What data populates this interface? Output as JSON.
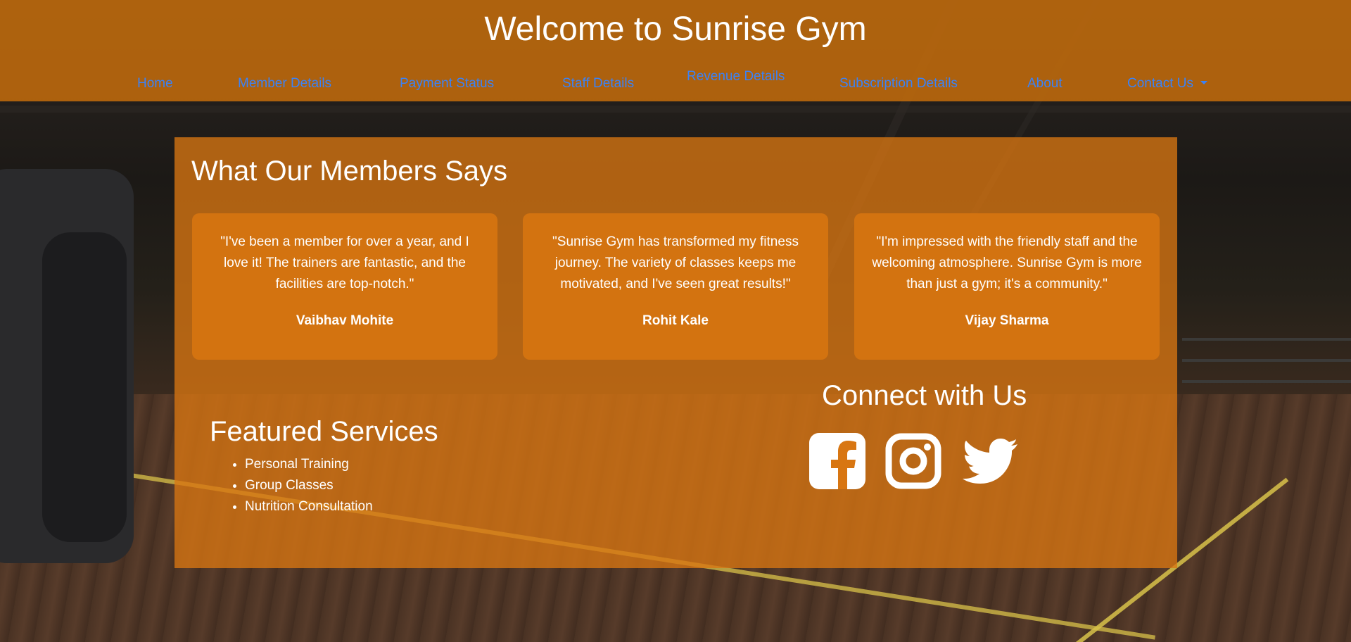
{
  "header": {
    "title": "Welcome to Sunrise Gym",
    "nav": [
      {
        "label": "Home"
      },
      {
        "label": "Member Details"
      },
      {
        "label": "Payment Status"
      },
      {
        "label": "Staff Details"
      },
      {
        "label": "Revenue Details"
      },
      {
        "label": "Subscription Details"
      },
      {
        "label": "About"
      },
      {
        "label": "Contact Us"
      }
    ]
  },
  "testimonials": {
    "title": "What Our Members Says",
    "items": [
      {
        "quote": "\"I've been a member for over a year, and I love it! The trainers are fantastic, and the facilities are top-notch.\"",
        "author": "Vaibhav Mohite"
      },
      {
        "quote": "\"Sunrise Gym has transformed my fitness journey. The variety of classes keeps me motivated, and I've seen great results!\"",
        "author": "Rohit Kale"
      },
      {
        "quote": "\"I'm impressed with the friendly staff and the welcoming atmosphere. Sunrise Gym is more than just a gym; it's a community.\"",
        "author": "Vijay Sharma"
      }
    ]
  },
  "services": {
    "title": "Featured Services",
    "items": [
      "Personal Training",
      "Group Classes",
      "Nutrition Consultation"
    ]
  },
  "connect": {
    "title": "Connect with Us",
    "icons": [
      "facebook-icon",
      "instagram-icon",
      "twitter-icon"
    ]
  },
  "colors": {
    "header_overlay": "#c46c0c",
    "panel_overlay": "#d87612",
    "nav_link": "#3b82f6",
    "text": "#ffffff"
  }
}
